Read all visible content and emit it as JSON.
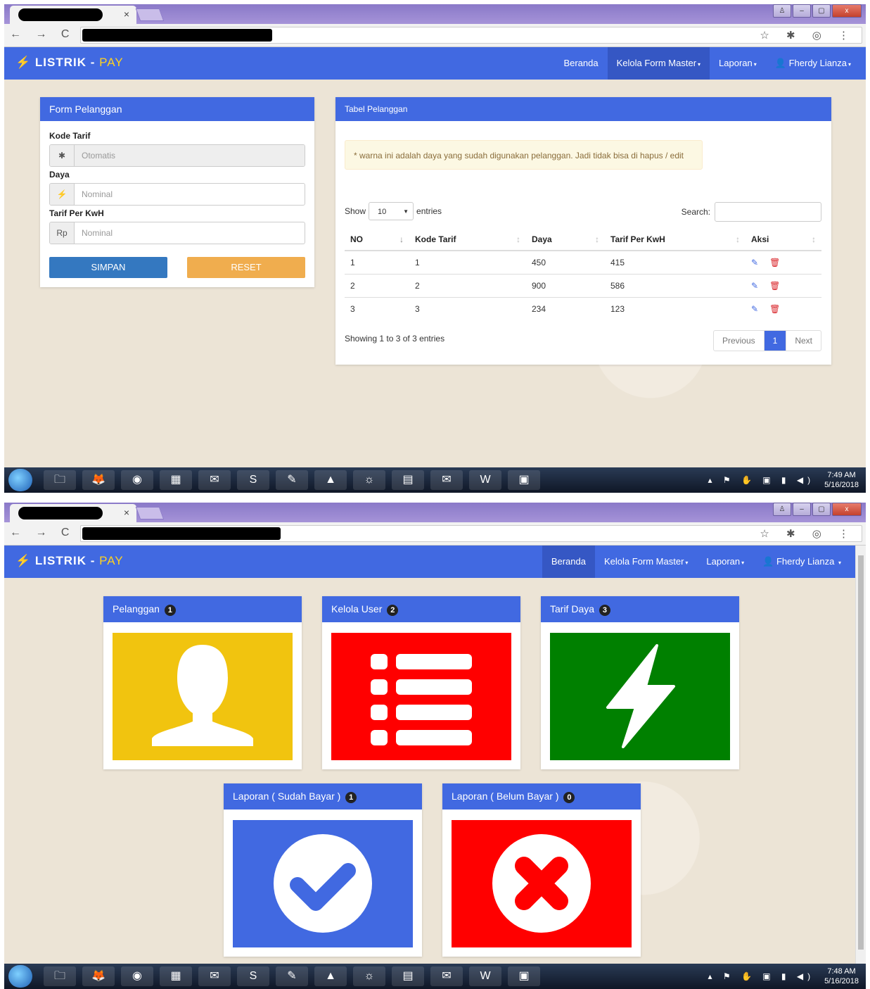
{
  "browser": {
    "tab_close": "×",
    "window_buttons": [
      "♙",
      "–",
      "▢",
      "x"
    ],
    "nav_icons": "← → C ⌂",
    "url_icons": "☆ ✱ ◎ ⋮"
  },
  "app": {
    "brand_icon": "⚡",
    "brand_main": "LISTRIK - ",
    "brand_accent": "PAY",
    "accent_color": "#4169e1",
    "menu": {
      "beranda": "Beranda",
      "kelola": "Kelola Form Master",
      "laporan": "Laporan",
      "user": "Fherdy Lianza",
      "user_icon": "👤",
      "caret": "▾"
    }
  },
  "form": {
    "title": "Form Pelanggan",
    "kode_tarif_label": "Kode Tarif",
    "kode_tarif_icon": "✱",
    "kode_tarif_placeholder": "Otomatis",
    "daya_label": "Daya",
    "daya_icon": "⚡",
    "daya_placeholder": "Nominal",
    "tarif_label": "Tarif Per KwH",
    "tarif_prefix": "Rp",
    "tarif_placeholder": "Nominal",
    "save_label": "SIMPAN",
    "reset_label": "RESET"
  },
  "table": {
    "title": "Tabel Pelanggan",
    "notice": "* warna ini adalah daya yang sudah digunakan pelanggan. Jadi tidak bisa di hapus / edit",
    "show_label": "Show",
    "entries_value": "10",
    "entries_label": "entries",
    "search_label": "Search:",
    "columns": [
      "NO",
      "Kode Tarif",
      "Daya",
      "Tarif Per KwH",
      "Aksi"
    ],
    "rows": [
      [
        "1",
        "1",
        "450",
        "415"
      ],
      [
        "2",
        "2",
        "900",
        "586"
      ],
      [
        "3",
        "3",
        "234",
        "123"
      ]
    ],
    "edit_icon": "✎",
    "delete_icon": "🗑",
    "info": "Showing 1 to 3 of 3 entries",
    "prev": "Previous",
    "page": "1",
    "next": "Next"
  },
  "dashboard": {
    "tiles": [
      {
        "title": "Pelanggan",
        "badge": "1",
        "color": "#f1c40f"
      },
      {
        "title": "Kelola User",
        "badge": "2",
        "color": "#ff0000"
      },
      {
        "title": "Tarif Daya",
        "badge": "3",
        "color": "#008000"
      },
      {
        "title": "Laporan ( Sudah Bayar )",
        "badge": "1",
        "color": "#4169e1"
      },
      {
        "title": "Laporan ( Belum Bayar )",
        "badge": "0",
        "color": "#ff0000"
      }
    ]
  },
  "taskbar": {
    "apps": [
      "🗀",
      "🦊",
      "◉",
      "▦",
      "✉",
      "S",
      "✎",
      "▲",
      "☼",
      "▤",
      "✉",
      "W",
      "▣"
    ],
    "tray_icons": "▴ ⚑ ✋ ▣ ▮ ◀)",
    "clock1_time": "7:49 AM",
    "clock2_time": "7:48 AM",
    "date": "5/16/2018"
  }
}
